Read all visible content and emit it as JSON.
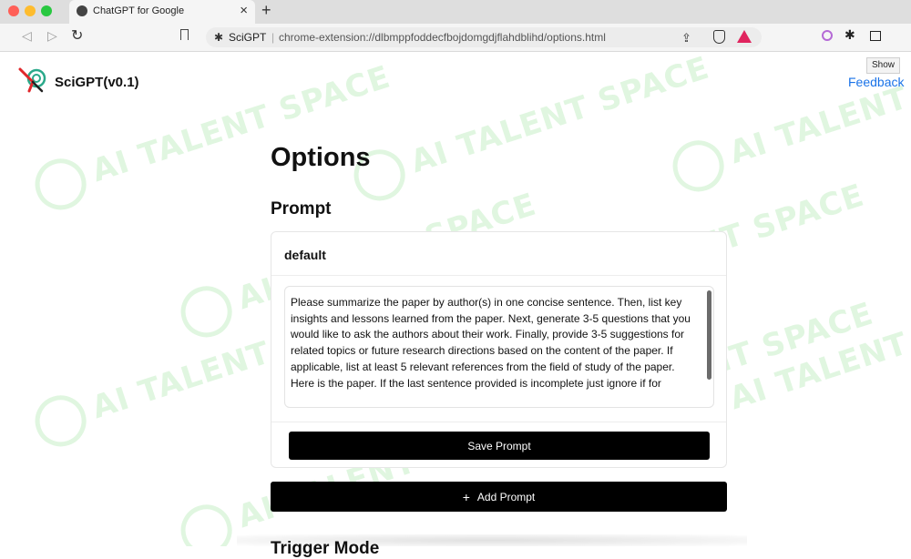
{
  "browser": {
    "tab_title": "ChatGPT for Google",
    "tab_close": "×",
    "new_tab": "+",
    "omnibox": {
      "extension_name": "SciGPT",
      "separator": "|",
      "url": "chrome-extension://dlbmppfoddecfbojdomgdjflahdblihd/options.html"
    },
    "tooltip": "Show"
  },
  "header": {
    "app_title": "SciGPT(v0.1)",
    "feedback_link": "Feedback"
  },
  "main": {
    "heading": "Options",
    "prompt_section_title": "Prompt",
    "prompt_card": {
      "title": "default",
      "text": "Please summarize the paper by author(s) in one concise sentence. Then, list key insights and lessons learned from the paper. Next, generate 3-5 questions that you would like to ask the authors about their work. Finally, provide 3-5 suggestions for related topics or future research directions  based on the content of the paper. If applicable, list at least 5 relevant references from the field of study of the paper. Here is the paper. If the last sentence provided is incomplete just ignore if for",
      "save_label": "Save Prompt"
    },
    "add_prompt_label": "Add Prompt",
    "next_section_partial": "Trigger Mode"
  },
  "watermark": "AI TALENT SPACE",
  "colors": {
    "primary_button": "#000000",
    "link": "#1a73e8",
    "watermark": "#c8efc8",
    "traffic_red": "#ff5f57",
    "traffic_yellow": "#febc2e",
    "traffic_green": "#28c840"
  },
  "icons": [
    "globe-icon",
    "back-arrow-icon",
    "forward-arrow-icon",
    "reload-icon",
    "bookmark-icon",
    "puzzle-icon",
    "share-icon",
    "brave-shield-icon",
    "brave-rewards-icon",
    "extension-icon",
    "extensions-puzzle-icon",
    "sidebar-icon",
    "scigpt-logo-icon",
    "plus-icon"
  ]
}
